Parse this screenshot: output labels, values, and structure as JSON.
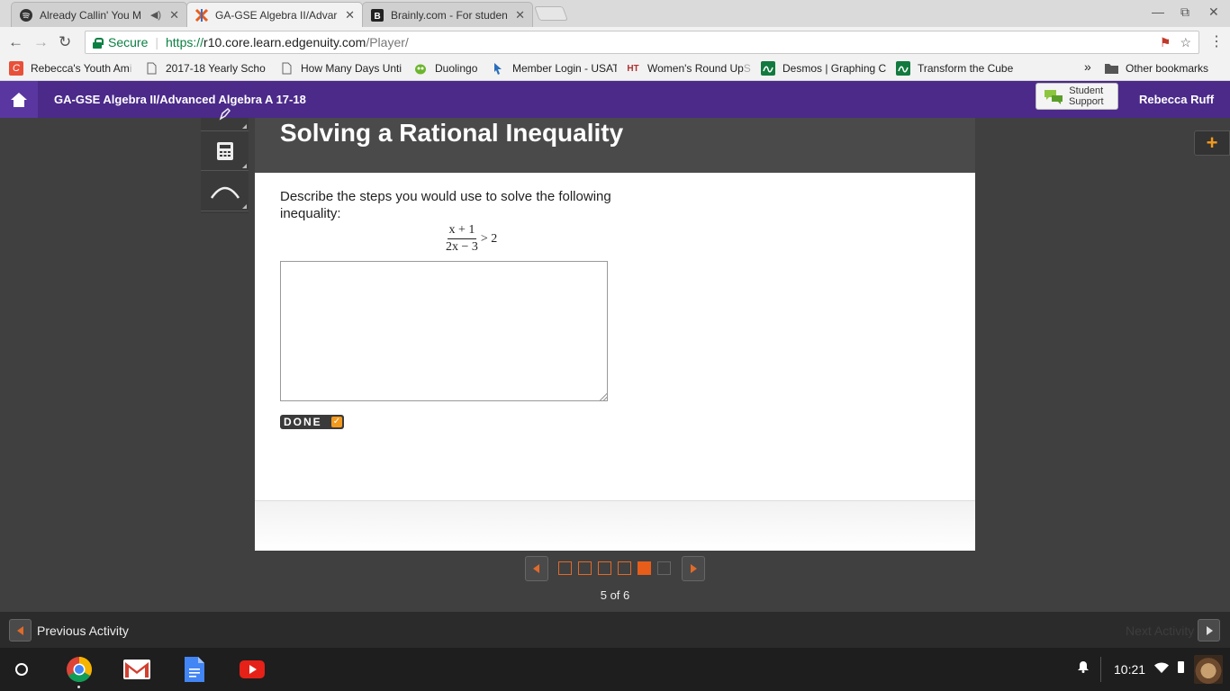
{
  "tabs": [
    {
      "label": "Already Callin' You M",
      "icon": "spotify-icon"
    },
    {
      "label": "GA-GSE Algebra II/Advar",
      "icon": "edgenuity-icon"
    },
    {
      "label": "Brainly.com - For studen",
      "icon": "brainly-icon"
    }
  ],
  "address": {
    "secure_label": "Secure",
    "protocol": "https://",
    "host": "r10.core.learn.edgenuity.com",
    "path": "/Player/"
  },
  "bookmarks": [
    {
      "label": "Rebecca's Youth Am",
      "fade": "i",
      "icon": "ce-icon"
    },
    {
      "label": "2017-18 Yearly Scho",
      "fade": "",
      "icon": "page-icon"
    },
    {
      "label": "How Many Days Unti",
      "fade": "",
      "icon": "page-icon"
    },
    {
      "label": "Duolingo",
      "fade": "",
      "icon": "duolingo-icon"
    },
    {
      "label": "Member Login - USAT",
      "fade": "",
      "icon": "cursor-icon"
    },
    {
      "label": "Women's Round Up",
      "fade": "S",
      "icon": "ht-icon"
    },
    {
      "label": "Desmos | Graphing C",
      "fade": "",
      "icon": "desmos-icon"
    },
    {
      "label": "Transform the Cube",
      "fade": "",
      "icon": "desmos-icon"
    }
  ],
  "bookmarks_overflow": "»",
  "other_bookmarks": "Other bookmarks",
  "course": {
    "title": "GA-GSE Algebra II/Advanced Algebra A 17-18"
  },
  "support": {
    "line1": "Student",
    "line2": "Support"
  },
  "user": {
    "name": "Rebecca Ruff"
  },
  "lesson": {
    "title": "Solving a Rational Inequality"
  },
  "question": {
    "prompt": "Describe the steps you would use to solve the following inequality:",
    "numerator": "x + 1",
    "denominator": "2x − 3",
    "relation": "> 2"
  },
  "answer": {
    "value": ""
  },
  "done_label": "DONE",
  "pager": {
    "current": 5,
    "total": 6,
    "label": "5 of 6"
  },
  "activity_nav": {
    "prev_label": "Previous Activity",
    "next_label": "Next Activity"
  },
  "shelf": {
    "time": "10:21"
  },
  "colors": {
    "brand_purple": "#4b2a8a",
    "accent_orange": "#e85d1a",
    "secure_green": "#0b8043"
  }
}
